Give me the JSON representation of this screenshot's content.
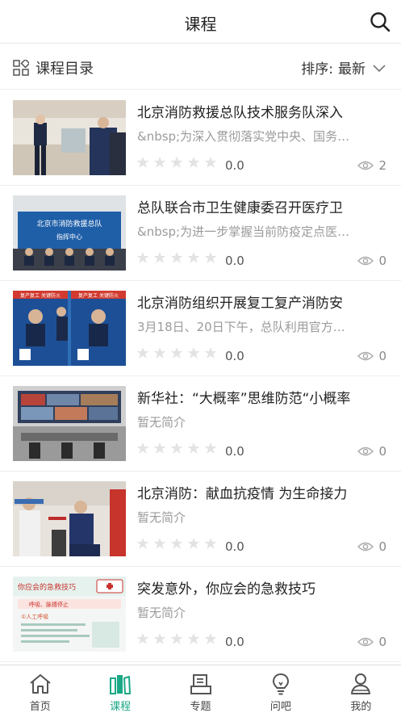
{
  "header": {
    "title": "课程"
  },
  "subbar": {
    "catalog_label": "课程目录",
    "sort_prefix": "排序:",
    "sort_value": "最新"
  },
  "courses": [
    {
      "title": "北京消防救援总队技术服务队深入",
      "desc": "&nbsp;为深入贯彻落实党中央、国务…",
      "rating": "0.0",
      "views": "2"
    },
    {
      "title": "总队联合市卫生健康委召开医疗卫",
      "desc": "&nbsp;为进一步掌握当前防疫定点医…",
      "rating": "0.0",
      "views": "0"
    },
    {
      "title": "北京消防组织开展复工复产消防安",
      "desc": "3月18日、20日下午，总队利用官方微…",
      "rating": "0.0",
      "views": "0"
    },
    {
      "title": "新华社：“大概率”思维防范“小概率",
      "desc": "暂无简介",
      "rating": "0.0",
      "views": "0"
    },
    {
      "title": "北京消防：献血抗疫情 为生命接力",
      "desc": "暂无简介",
      "rating": "0.0",
      "views": "0"
    },
    {
      "title": "突发意外，你应会的急救技巧",
      "desc": "暂无简介",
      "rating": "0.0",
      "views": "0"
    }
  ],
  "thumb_text": {
    "t2_banner1": "北京市消防救援总队",
    "t2_banner2": "指挥中心",
    "t3_left": "复产复工 关键防火",
    "t3_right": "复产复工 关键防火",
    "t6_title": "你应会的急救技巧",
    "t6_sub1": "呼吸、脉搏停止",
    "t6_sub2": "①人工呼吸"
  },
  "tabs": [
    {
      "label": "首页",
      "icon": "home-icon",
      "active": false
    },
    {
      "label": "课程",
      "icon": "course-icon",
      "active": true
    },
    {
      "label": "专题",
      "icon": "topic-icon",
      "active": false
    },
    {
      "label": "问吧",
      "icon": "qa-bulb-icon",
      "active": false
    },
    {
      "label": "我的",
      "icon": "profile-icon",
      "active": false
    }
  ],
  "colors": {
    "accent": "#1aa886",
    "star_empty": "#e3e3e3",
    "divider": "#ededed"
  }
}
